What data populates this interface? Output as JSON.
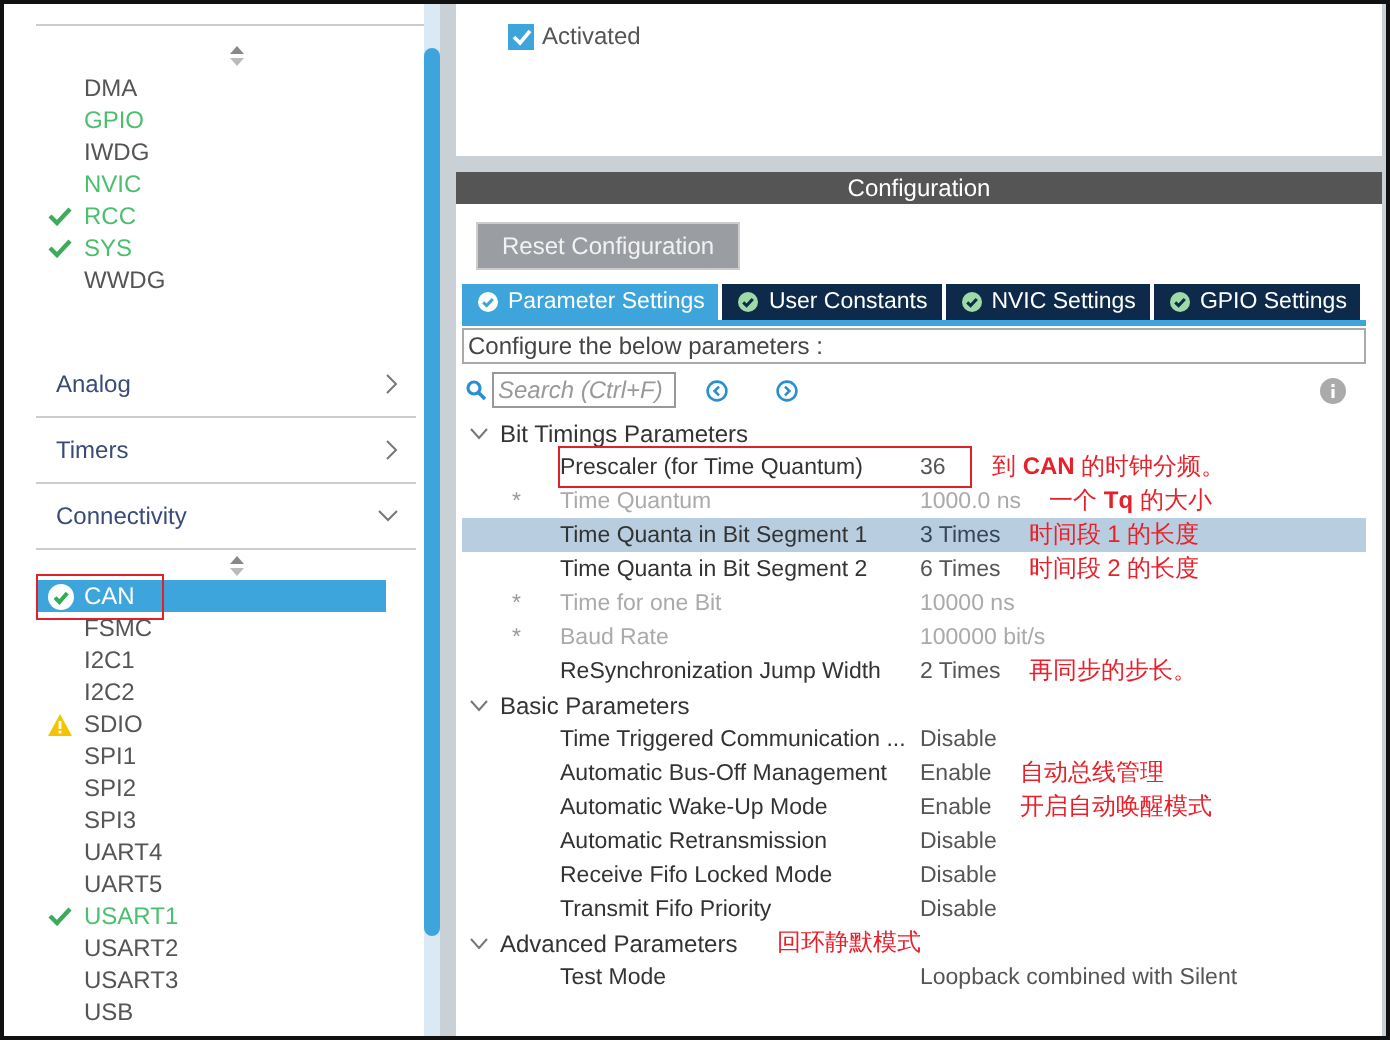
{
  "sidebar": {
    "items": [
      {
        "label": "DMA",
        "configured": false,
        "checked": false,
        "warning": false,
        "selected": false,
        "boxed": false
      },
      {
        "label": "GPIO",
        "configured": true,
        "checked": false,
        "warning": false,
        "selected": false,
        "boxed": false
      },
      {
        "label": "IWDG",
        "configured": false,
        "checked": false,
        "warning": false,
        "selected": false,
        "boxed": false
      },
      {
        "label": "NVIC",
        "configured": true,
        "checked": false,
        "warning": false,
        "selected": false,
        "boxed": false
      },
      {
        "label": "RCC",
        "configured": true,
        "checked": true,
        "warning": false,
        "selected": false,
        "boxed": false
      },
      {
        "label": "SYS",
        "configured": true,
        "checked": true,
        "warning": false,
        "selected": false,
        "boxed": false
      },
      {
        "label": "WWDG",
        "configured": false,
        "checked": false,
        "warning": false,
        "selected": false,
        "boxed": false
      }
    ],
    "categories": [
      {
        "label": "Analog",
        "expanded": false
      },
      {
        "label": "Timers",
        "expanded": false
      },
      {
        "label": "Connectivity",
        "expanded": true
      }
    ],
    "connectivity_items": [
      {
        "label": "CAN",
        "configured": true,
        "checked": true,
        "warning": false,
        "selected": true,
        "boxed": true
      },
      {
        "label": "FSMC",
        "configured": false,
        "checked": false,
        "warning": false,
        "selected": false,
        "boxed": false
      },
      {
        "label": "I2C1",
        "configured": false,
        "checked": false,
        "warning": false,
        "selected": false,
        "boxed": false
      },
      {
        "label": "I2C2",
        "configured": false,
        "checked": false,
        "warning": false,
        "selected": false,
        "boxed": false
      },
      {
        "label": "SDIO",
        "configured": false,
        "checked": false,
        "warning": true,
        "selected": false,
        "boxed": false
      },
      {
        "label": "SPI1",
        "configured": false,
        "checked": false,
        "warning": false,
        "selected": false,
        "boxed": false
      },
      {
        "label": "SPI2",
        "configured": false,
        "checked": false,
        "warning": false,
        "selected": false,
        "boxed": false
      },
      {
        "label": "SPI3",
        "configured": false,
        "checked": false,
        "warning": false,
        "selected": false,
        "boxed": false
      },
      {
        "label": "UART4",
        "configured": false,
        "checked": false,
        "warning": false,
        "selected": false,
        "boxed": false
      },
      {
        "label": "UART5",
        "configured": false,
        "checked": false,
        "warning": false,
        "selected": false,
        "boxed": false
      },
      {
        "label": "USART1",
        "configured": true,
        "checked": true,
        "warning": false,
        "selected": false,
        "boxed": false
      },
      {
        "label": "USART2",
        "configured": false,
        "checked": false,
        "warning": false,
        "selected": false,
        "boxed": false
      },
      {
        "label": "USART3",
        "configured": false,
        "checked": false,
        "warning": false,
        "selected": false,
        "boxed": false
      },
      {
        "label": "USB",
        "configured": false,
        "checked": false,
        "warning": false,
        "selected": false,
        "boxed": false
      }
    ]
  },
  "mode": {
    "checkbox": {
      "label": "Activated",
      "checked": true
    }
  },
  "configuration": {
    "title": "Configuration",
    "reset_button": "Reset Configuration",
    "tabs": [
      {
        "label": "Parameter Settings",
        "selected": true
      },
      {
        "label": "User Constants",
        "selected": false
      },
      {
        "label": "NVIC Settings",
        "selected": false
      },
      {
        "label": "GPIO Settings",
        "selected": false
      }
    ],
    "description": "Configure the below parameters :",
    "search": {
      "placeholder": "Search (Ctrl+F)"
    },
    "groups": [
      {
        "label": "Bit Timings Parameters",
        "expanded": true,
        "rows": [
          {
            "label": "Prescaler (for Time Quantum)",
            "value": "36",
            "derived": false,
            "selected": false,
            "boxed": true,
            "note": "到 **CAN** 的时钟分频。"
          },
          {
            "marker": "*",
            "label": "Time Quantum",
            "value": "1000.0 ns",
            "derived": true,
            "selected": false,
            "boxed": false,
            "note": "一个 **Tq** 的大小"
          },
          {
            "label": "Time Quanta in Bit Segment 1",
            "value": "3 Times",
            "derived": false,
            "selected": true,
            "boxed": false,
            "note": "时间段 1 的长度"
          },
          {
            "label": "Time Quanta in Bit Segment 2",
            "value": "6 Times",
            "derived": false,
            "selected": false,
            "boxed": false,
            "note": "时间段 2 的长度"
          },
          {
            "marker": "*",
            "label": "Time for one Bit",
            "value": "10000 ns",
            "derived": true,
            "selected": false,
            "boxed": false
          },
          {
            "marker": "*",
            "label": "Baud Rate",
            "value": "100000 bit/s",
            "derived": true,
            "selected": false,
            "boxed": false
          },
          {
            "label": "ReSynchronization Jump Width",
            "value": "2 Times",
            "derived": false,
            "selected": false,
            "boxed": false,
            "note": "再同步的步长。"
          }
        ]
      },
      {
        "label": "Basic Parameters",
        "expanded": true,
        "rows": [
          {
            "label": "Time Triggered Communication ...",
            "value": "Disable",
            "derived": false,
            "selected": false,
            "boxed": false
          },
          {
            "label": "Automatic Bus-Off Management",
            "value": "Enable",
            "derived": false,
            "selected": false,
            "boxed": false,
            "note": "自动总线管理"
          },
          {
            "label": "Automatic Wake-Up Mode",
            "value": "Enable",
            "derived": false,
            "selected": false,
            "boxed": false,
            "note": "开启自动唤醒模式"
          },
          {
            "label": "Automatic Retransmission",
            "value": "Disable",
            "derived": false,
            "selected": false,
            "boxed": false
          },
          {
            "label": "Receive Fifo Locked Mode",
            "value": "Disable",
            "derived": false,
            "selected": false,
            "boxed": false
          },
          {
            "label": "Transmit Fifo Priority",
            "value": "Disable",
            "derived": false,
            "selected": false,
            "boxed": false
          }
        ]
      },
      {
        "label": "Advanced Parameters",
        "expanded": true,
        "note": "回环静默模式",
        "rows": [
          {
            "label": "Test Mode",
            "value": "Loopback combined with Silent",
            "derived": false,
            "selected": false,
            "boxed": false
          }
        ]
      }
    ]
  }
}
